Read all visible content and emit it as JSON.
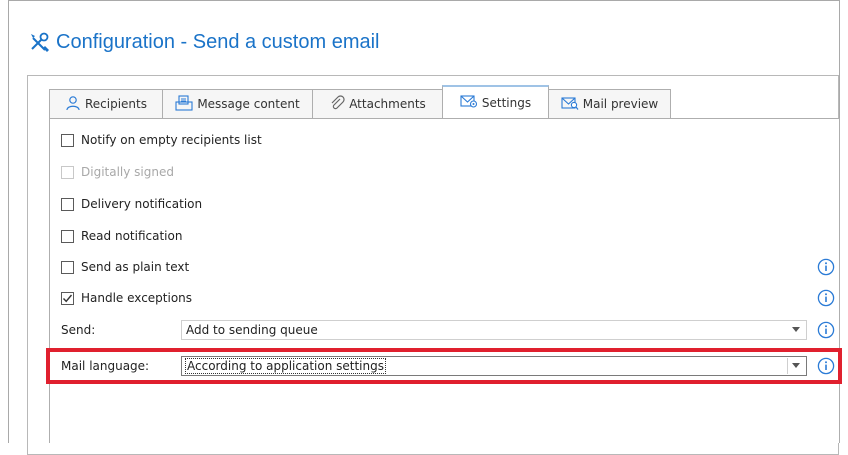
{
  "title": {
    "text": "Configuration - Send a custom email",
    "icon": "tools-icon"
  },
  "tabs": [
    {
      "label": "Recipients",
      "icon": "person-icon",
      "active": false
    },
    {
      "label": "Message content",
      "icon": "document-icon",
      "active": false
    },
    {
      "label": "Attachments",
      "icon": "paperclip-icon",
      "active": false
    },
    {
      "label": "Settings",
      "icon": "envelope-gear-icon",
      "active": true
    },
    {
      "label": "Mail preview",
      "icon": "envelope-search-icon",
      "active": false
    }
  ],
  "options": [
    {
      "label": "Notify on empty recipients list",
      "checked": false,
      "disabled": false,
      "info": false
    },
    {
      "label": "Digitally signed",
      "checked": false,
      "disabled": true,
      "info": false
    },
    {
      "label": "Delivery notification",
      "checked": false,
      "disabled": false,
      "info": false
    },
    {
      "label": "Read notification",
      "checked": false,
      "disabled": false,
      "info": false
    },
    {
      "label": "Send as plain text",
      "checked": false,
      "disabled": false,
      "info": true
    },
    {
      "label": "Handle exceptions",
      "checked": true,
      "disabled": false,
      "info": true
    }
  ],
  "send": {
    "label": "Send:",
    "value": "Add to sending queue"
  },
  "mail_language": {
    "label": "Mail language:",
    "value": "According to application settings"
  },
  "colors": {
    "accent": "#1a73c8",
    "highlight": "#e0202e",
    "info_icon": "#2b7bd6"
  }
}
